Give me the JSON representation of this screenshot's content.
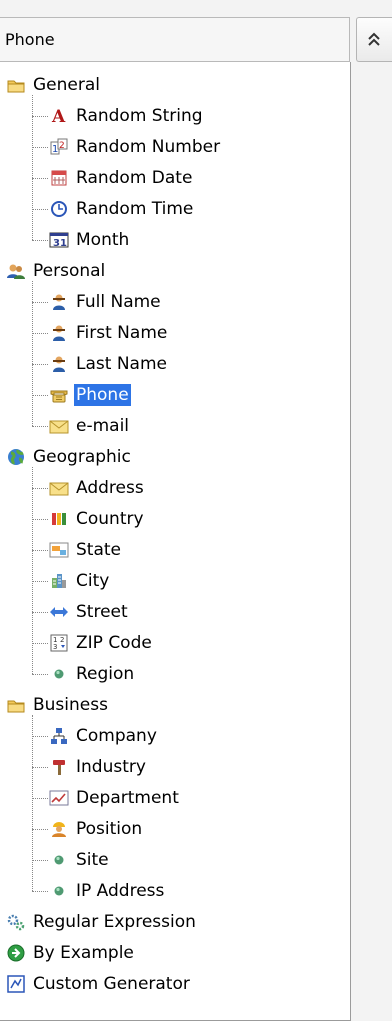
{
  "header": {
    "selected_value": "Phone"
  },
  "tree": {
    "groups": [
      {
        "label": "General",
        "icon": "folder-icon",
        "items": [
          {
            "label": "Random String",
            "icon": "string-icon"
          },
          {
            "label": "Random Number",
            "icon": "number-icon"
          },
          {
            "label": "Random Date",
            "icon": "calendar-icon"
          },
          {
            "label": "Random Time",
            "icon": "clock-icon"
          },
          {
            "label": "Month",
            "icon": "month-icon"
          }
        ]
      },
      {
        "label": "Personal",
        "icon": "people-icon",
        "items": [
          {
            "label": "Full Name",
            "icon": "person-icon"
          },
          {
            "label": "First Name",
            "icon": "person-icon"
          },
          {
            "label": "Last Name",
            "icon": "person-icon"
          },
          {
            "label": "Phone",
            "icon": "phone-icon",
            "selected": true
          },
          {
            "label": "e-mail",
            "icon": "envelope-icon"
          }
        ]
      },
      {
        "label": "Geographic",
        "icon": "globe-icon",
        "items": [
          {
            "label": "Address",
            "icon": "envelope-icon"
          },
          {
            "label": "Country",
            "icon": "flags-icon"
          },
          {
            "label": "State",
            "icon": "map-icon"
          },
          {
            "label": "City",
            "icon": "city-icon"
          },
          {
            "label": "Street",
            "icon": "double-arrow-icon"
          },
          {
            "label": "ZIP Code",
            "icon": "zip-icon"
          },
          {
            "label": "Region",
            "icon": "dot-icon"
          }
        ]
      },
      {
        "label": "Business",
        "icon": "folder-icon",
        "items": [
          {
            "label": "Company",
            "icon": "org-chart-icon"
          },
          {
            "label": "Industry",
            "icon": "hammer-icon"
          },
          {
            "label": "Department",
            "icon": "chart-icon"
          },
          {
            "label": "Position",
            "icon": "worker-icon"
          },
          {
            "label": "Site",
            "icon": "dot-icon"
          },
          {
            "label": "IP Address",
            "icon": "dot-icon"
          }
        ]
      }
    ],
    "roots": [
      {
        "label": "Regular Expression",
        "icon": "gears-icon"
      },
      {
        "label": "By Example",
        "icon": "arrow-circle-icon"
      },
      {
        "label": "Custom Generator",
        "icon": "custom-icon"
      }
    ]
  }
}
